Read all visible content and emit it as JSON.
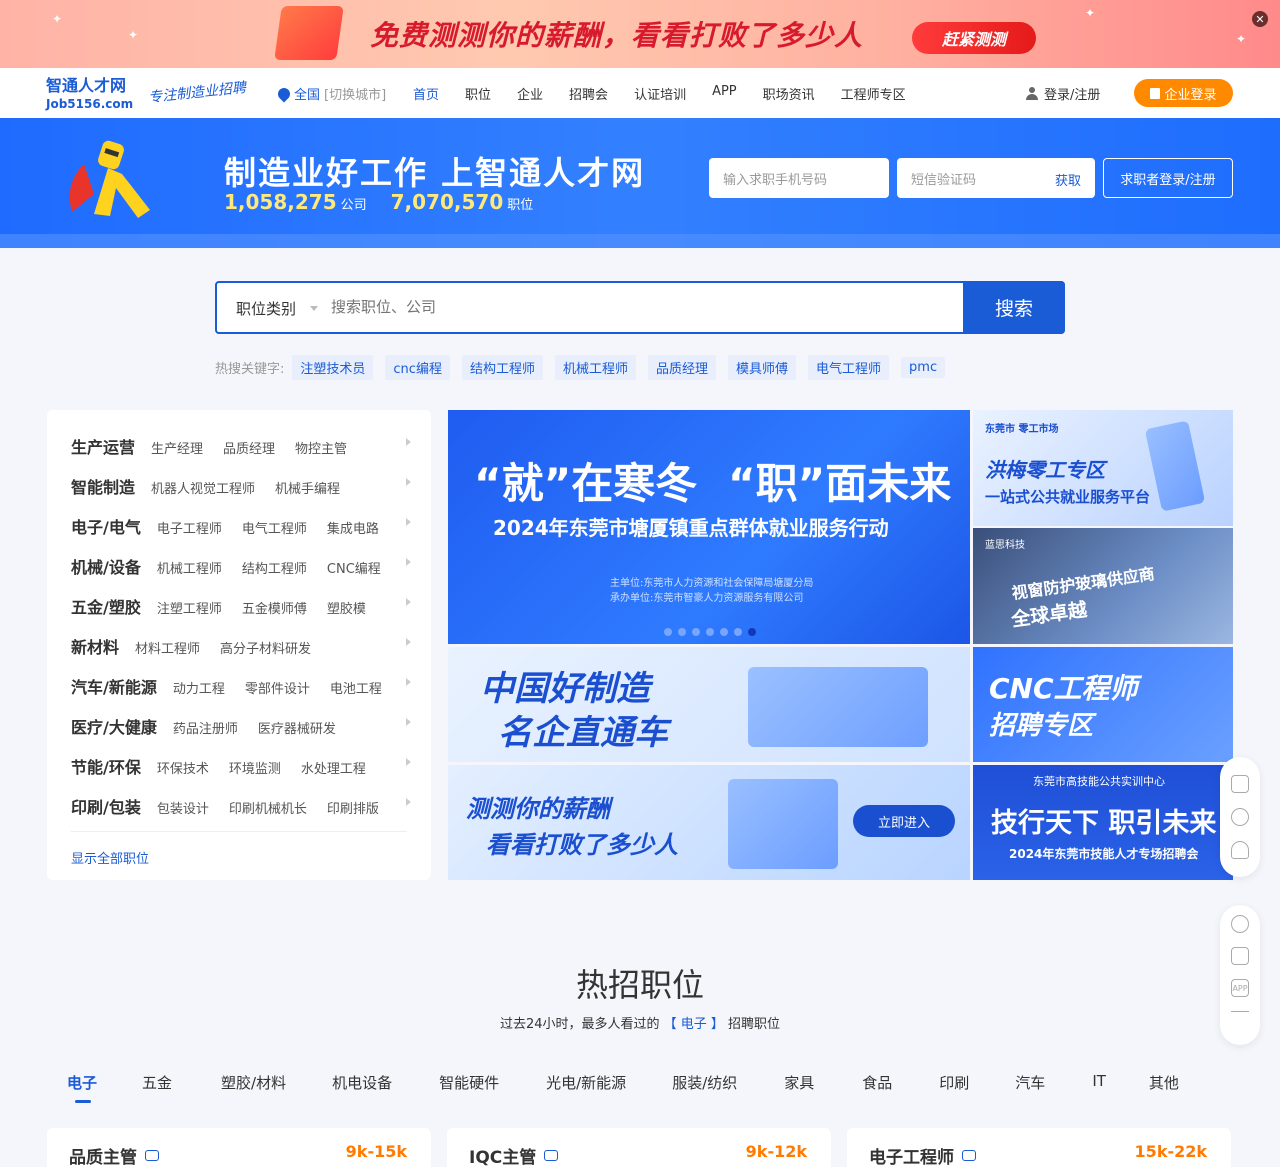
{
  "top_banner": {
    "text": "免费测测你的薪酬，看看打败了多少人",
    "button": "赶紧测测",
    "close": "✕"
  },
  "header": {
    "logo_cn": "智通人才网",
    "logo_en": "Job5156.com",
    "slogan": "专注制造业招聘",
    "location": "全国",
    "switch_city": "[切换城市]",
    "nav": [
      "首页",
      "职位",
      "企业",
      "招聘会",
      "认证培训",
      "APP",
      "职场资讯",
      "工程师专区"
    ],
    "login": "登录/注册",
    "corp_login": "企业登录"
  },
  "hero": {
    "title": "制造业好工作 上智通人才网",
    "company_count": "1,058,275",
    "company_unit": "公司",
    "job_count": "7,070,570",
    "job_unit": "职位",
    "phone_placeholder": "输入求职手机号码",
    "sms_placeholder": "短信验证码",
    "get_code": "获取",
    "seeker_btn": "求职者登录/注册"
  },
  "search": {
    "category": "职位类别",
    "placeholder": "搜索职位、公司",
    "button": "搜索",
    "hot_label": "热搜关键字:",
    "hot_keywords": [
      "注塑技术员",
      "cnc编程",
      "结构工程师",
      "机械工程师",
      "品质经理",
      "模具师傅",
      "电气工程师",
      "pmc"
    ]
  },
  "categories": [
    {
      "name": "生产运营",
      "subs": [
        "生产经理",
        "品质经理",
        "物控主管"
      ]
    },
    {
      "name": "智能制造",
      "subs": [
        "机器人视觉工程师",
        "机械手编程"
      ]
    },
    {
      "name": "电子/电气",
      "subs": [
        "电子工程师",
        "电气工程师",
        "集成电路"
      ]
    },
    {
      "name": "机械/设备",
      "subs": [
        "机械工程师",
        "结构工程师",
        "CNC编程"
      ]
    },
    {
      "name": "五金/塑胶",
      "subs": [
        "注塑工程师",
        "五金模师傅",
        "塑胶模"
      ]
    },
    {
      "name": "新材料",
      "subs": [
        "材料工程师",
        "高分子材料研发"
      ]
    },
    {
      "name": "汽车/新能源",
      "subs": [
        "动力工程",
        "零部件设计",
        "电池工程"
      ]
    },
    {
      "name": "医疗/大健康",
      "subs": [
        "药品注册师",
        "医疗器械研发"
      ]
    },
    {
      "name": "节能/环保",
      "subs": [
        "环保技术",
        "环境监测",
        "水处理工程"
      ]
    },
    {
      "name": "印刷/包装",
      "subs": [
        "包装设计",
        "印刷机械机长",
        "印刷排版"
      ]
    }
  ],
  "show_all": "显示全部职位",
  "banners": {
    "main": {
      "q1": "“就”在寒冬",
      "q2": "“职”面未来",
      "subtitle": "2024年东莞市塘厦镇重点群体就业服务行动",
      "host": "主单位:东莞市人力资源和社会保障局塘厦分局",
      "organizer": "承办单位:东莞市智豪人力资源服务有限公司",
      "slides": 7,
      "active_slide": 7
    },
    "b1": {
      "badge": "东莞市 零工市场",
      "title": "洪梅零工专区",
      "sub": "一站式公共就业服务平台"
    },
    "b2": {
      "brand": "蓝思科技",
      "line1": "视窗防护玻璃供应商",
      "line2": "全球卓越"
    },
    "b3": {
      "line1": "中国好制造",
      "line2": "名企直通车"
    },
    "b4": {
      "line1": "CNC工程师",
      "line2": "招聘专区"
    },
    "b5": {
      "line1": "测测你的薪酬",
      "line2": "看看打败了多少人",
      "button": "立即进入"
    },
    "b6": {
      "org": "东莞市高技能公共实训中心",
      "title": "技行天下 职引未来",
      "sub": "2024年东莞市技能人才专场招聘会"
    }
  },
  "float_tools": {
    "app_label": "APP"
  },
  "hot_jobs": {
    "title": "热招职位",
    "sub_prefix": "过去24小时，最多人看过的",
    "sub_highlight": "【 电子 】",
    "sub_suffix": "招聘职位",
    "tabs": [
      "电子",
      "五金",
      "塑胶/材料",
      "机电设备",
      "智能硬件",
      "光电/新能源",
      "服装/纺织",
      "家具",
      "食品",
      "印刷",
      "汽车",
      "IT",
      "其他"
    ],
    "jobs": [
      {
        "title": "品质主管",
        "salary": "9k-15k"
      },
      {
        "title": "IQC主管",
        "salary": "9k-12k"
      },
      {
        "title": "电子工程师",
        "salary": "15k-22k"
      }
    ]
  }
}
